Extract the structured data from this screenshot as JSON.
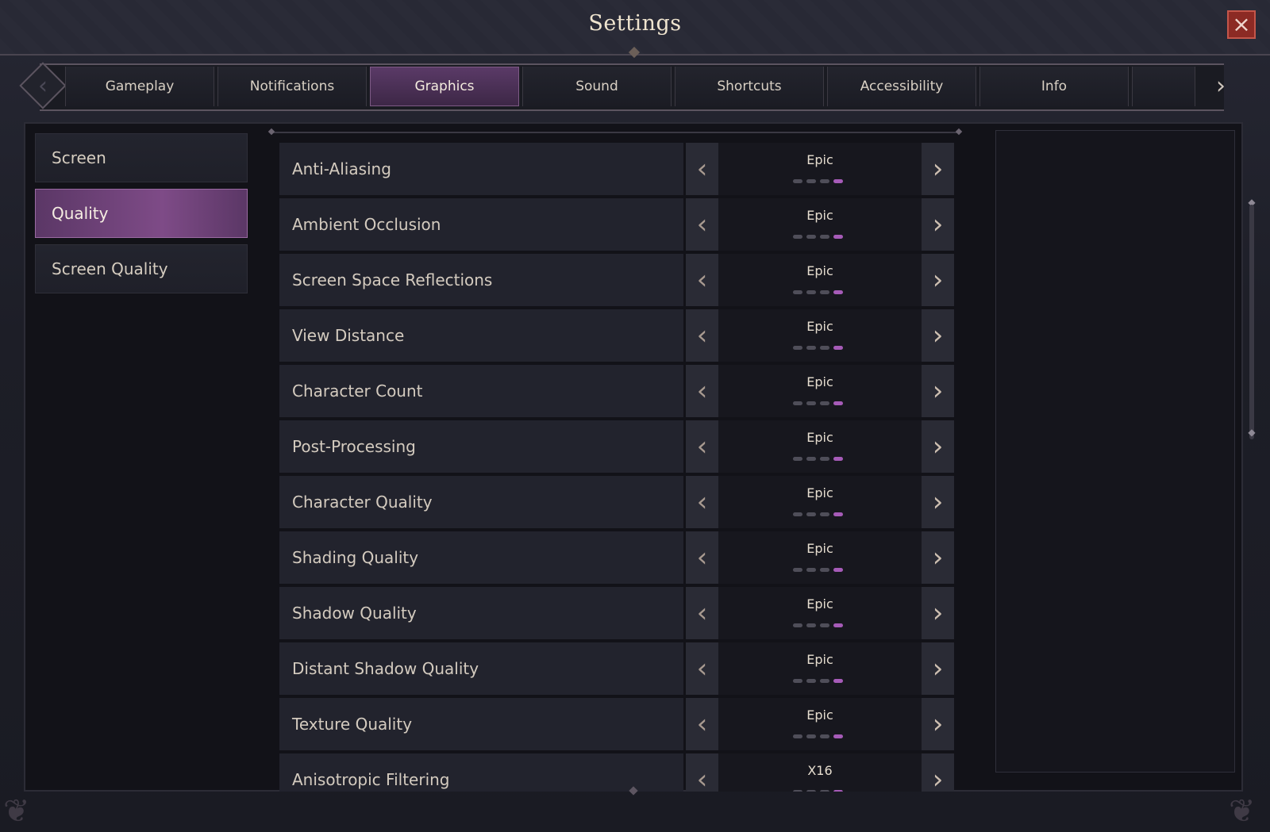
{
  "window": {
    "title": "Settings",
    "close_icon": "×"
  },
  "tabs": {
    "left_arrow": "‹",
    "right_arrow": "›",
    "items": [
      {
        "label": "Gameplay"
      },
      {
        "label": "Notifications"
      },
      {
        "label": "Graphics"
      },
      {
        "label": "Sound"
      },
      {
        "label": "Shortcuts"
      },
      {
        "label": "Accessibility"
      },
      {
        "label": "Info"
      }
    ],
    "active": "Graphics"
  },
  "sidebar": {
    "items": [
      {
        "label": "Screen"
      },
      {
        "label": "Quality"
      },
      {
        "label": "Screen Quality"
      }
    ],
    "active": "Quality"
  },
  "settings": {
    "prev_icon": "‹",
    "next_icon": "›",
    "rows": [
      {
        "label": "Anti-Aliasing",
        "value": "Epic",
        "level": 4,
        "max_level": 4
      },
      {
        "label": "Ambient Occlusion",
        "value": "Epic",
        "level": 4,
        "max_level": 4
      },
      {
        "label": "Screen Space Reflections",
        "value": "Epic",
        "level": 4,
        "max_level": 4
      },
      {
        "label": "View Distance",
        "value": "Epic",
        "level": 4,
        "max_level": 4
      },
      {
        "label": "Character Count",
        "value": "Epic",
        "level": 4,
        "max_level": 4
      },
      {
        "label": "Post-Processing",
        "value": "Epic",
        "level": 4,
        "max_level": 4
      },
      {
        "label": "Character Quality",
        "value": "Epic",
        "level": 4,
        "max_level": 4
      },
      {
        "label": "Shading Quality",
        "value": "Epic",
        "level": 4,
        "max_level": 4
      },
      {
        "label": "Shadow Quality",
        "value": "Epic",
        "level": 4,
        "max_level": 4
      },
      {
        "label": "Distant Shadow Quality",
        "value": "Epic",
        "level": 4,
        "max_level": 4
      },
      {
        "label": "Texture Quality",
        "value": "Epic",
        "level": 4,
        "max_level": 4
      },
      {
        "label": "Anisotropic Filtering",
        "value": "X16",
        "level": 4,
        "max_level": 4
      }
    ]
  },
  "colors": {
    "accent": "#a65bb8",
    "active_tab": "#5a3a67",
    "close": "#8c2a24"
  }
}
